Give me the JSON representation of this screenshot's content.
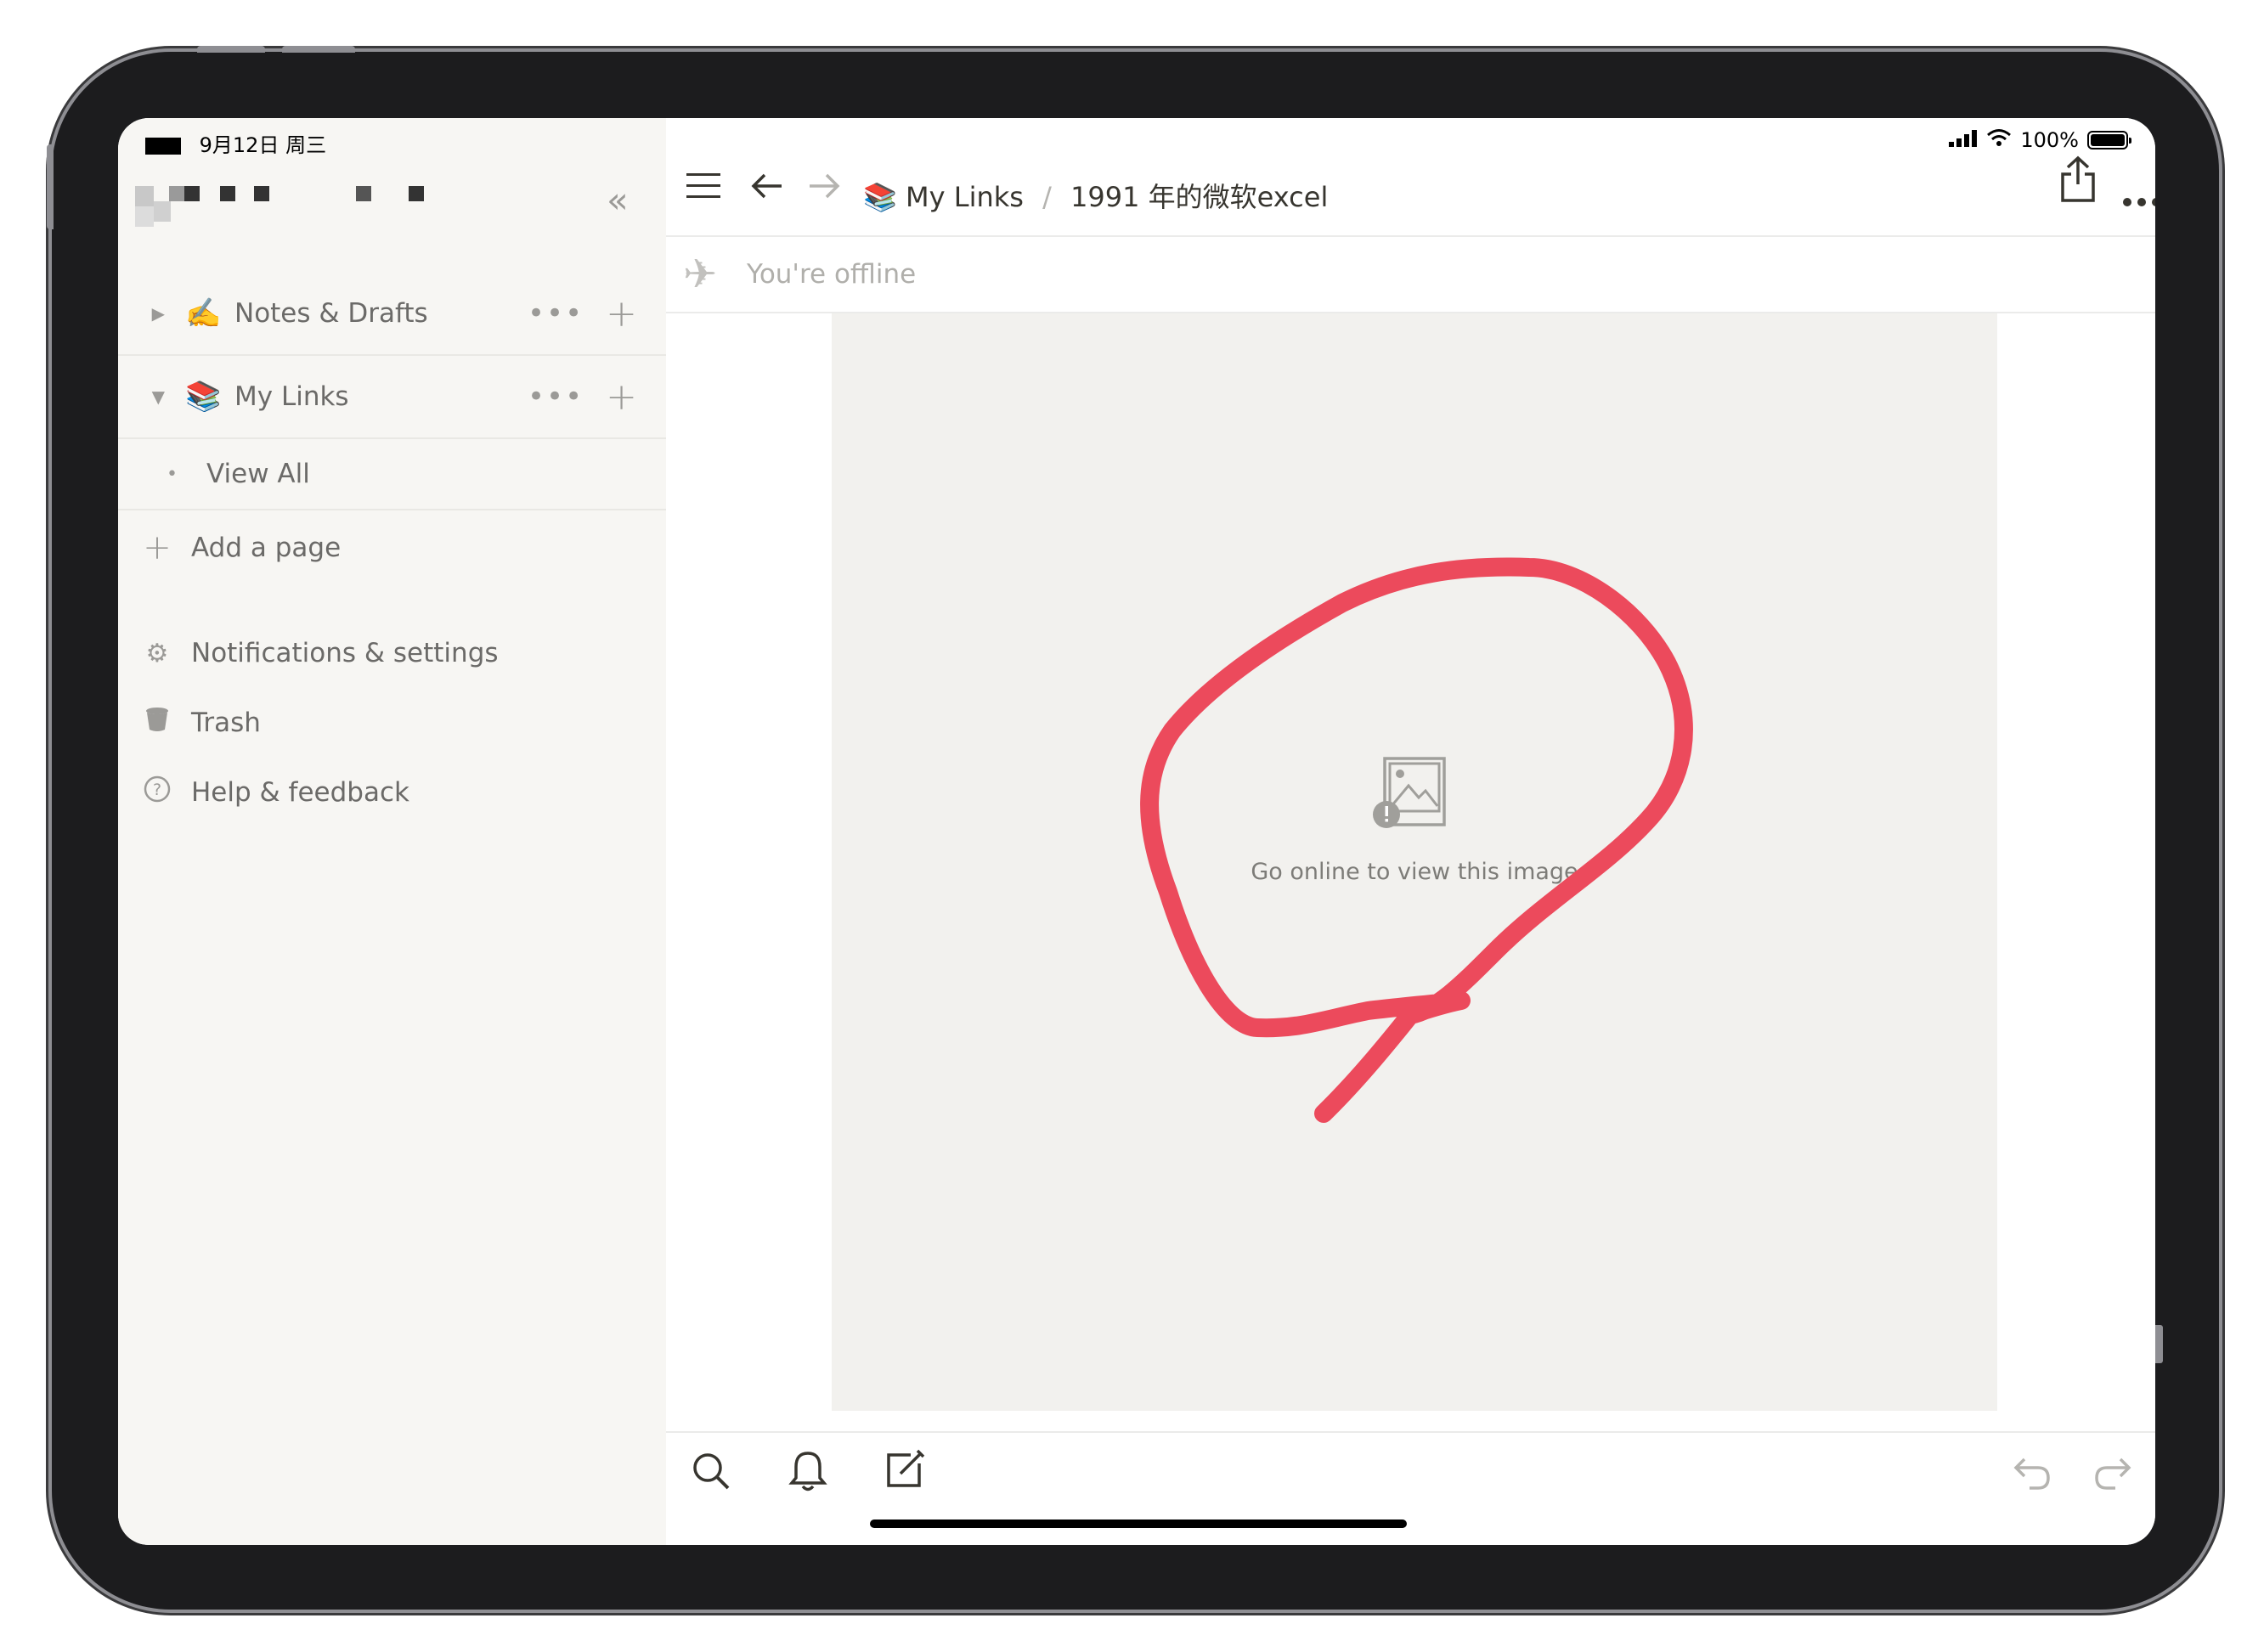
{
  "status_bar": {
    "date": "9月12日 周三",
    "battery": "100%"
  },
  "sidebar": {
    "sections": [
      {
        "emoji": "✍️",
        "label": "Notes & Drafts",
        "expanded": false
      },
      {
        "emoji": "📚",
        "label": "My Links",
        "expanded": true
      }
    ],
    "view_all": "View All",
    "add_page": "Add a page",
    "menu": [
      {
        "icon": "gear-icon",
        "label": "Notifications & settings"
      },
      {
        "icon": "trash-icon",
        "label": "Trash"
      },
      {
        "icon": "help-icon",
        "label": "Help & feedback"
      }
    ]
  },
  "topbar": {
    "breadcrumb": {
      "emoji": "📚",
      "parent": "My Links",
      "separator": "/",
      "current": "1991 年的微软excel"
    }
  },
  "offline": {
    "message": "You're offline"
  },
  "content": {
    "image_placeholder": "Go online to view this image"
  },
  "annotation": {
    "color": "#ec4a5c"
  }
}
